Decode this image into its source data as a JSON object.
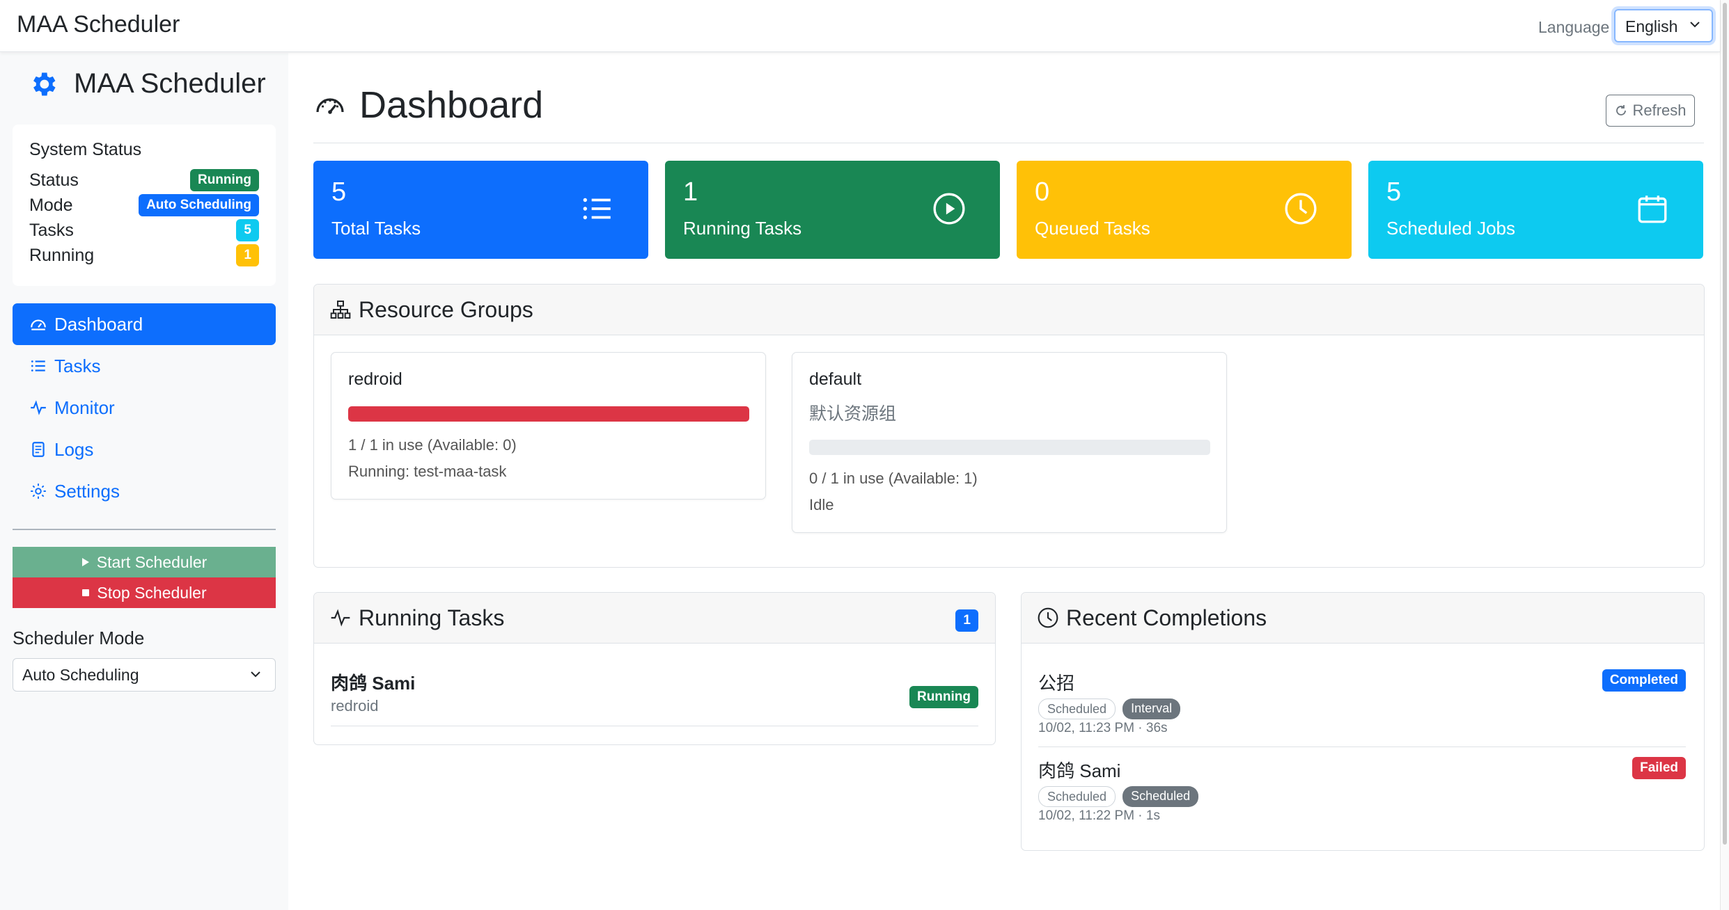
{
  "app": {
    "title": "MAA Scheduler",
    "language_label": "Language",
    "language_value": "English"
  },
  "sidebar": {
    "title": "MAA Scheduler",
    "status": {
      "header": "System Status",
      "rows": [
        {
          "label": "Status",
          "value": "Running"
        },
        {
          "label": "Mode",
          "value": "Auto Scheduling"
        },
        {
          "label": "Tasks",
          "value": "5"
        },
        {
          "label": "Running",
          "value": "1"
        }
      ]
    },
    "nav": [
      {
        "label": "Dashboard",
        "active": true
      },
      {
        "label": "Tasks"
      },
      {
        "label": "Monitor"
      },
      {
        "label": "Logs"
      },
      {
        "label": "Settings"
      }
    ],
    "start_button": "Start Scheduler",
    "stop_button": "Stop Scheduler",
    "mode_label": "Scheduler Mode",
    "mode_value": "Auto Scheduling"
  },
  "main": {
    "title": "Dashboard",
    "refresh": "Refresh",
    "stats": [
      {
        "value": "5",
        "label": "Total Tasks",
        "color": "#0d6efd"
      },
      {
        "value": "1",
        "label": "Running Tasks",
        "color": "#198754"
      },
      {
        "value": "0",
        "label": "Queued Tasks",
        "color": "#ffc107"
      },
      {
        "value": "5",
        "label": "Scheduled Jobs",
        "color": "#0dcaf0"
      }
    ],
    "resource_groups": {
      "title": "Resource Groups",
      "groups": [
        {
          "name": "redroid",
          "description": "",
          "usage": "1 / 1 in use (Available: 0)",
          "state": "Running: test-maa-task",
          "fill_fraction": 1.0
        },
        {
          "name": "default",
          "description": "默认资源组",
          "usage": "0 / 1 in use (Available: 1)",
          "state": "Idle",
          "fill_fraction": 0.0
        }
      ]
    },
    "running_tasks": {
      "title": "Running Tasks",
      "count": "1",
      "items": [
        {
          "name": "肉鸽 Sami",
          "group": "redroid",
          "status": "Running"
        }
      ]
    },
    "recent_completions": {
      "title": "Recent Completions",
      "items": [
        {
          "name": "公招",
          "tag1": "Scheduled",
          "tag2": "Interval",
          "meta": "10/02, 11:23 PM · 36s",
          "status": "Completed"
        },
        {
          "name": "肉鸽 Sami",
          "tag1": "Scheduled",
          "tag2": "Scheduled",
          "meta": "10/02, 11:22 PM · 1s",
          "status": "Failed"
        }
      ]
    }
  }
}
